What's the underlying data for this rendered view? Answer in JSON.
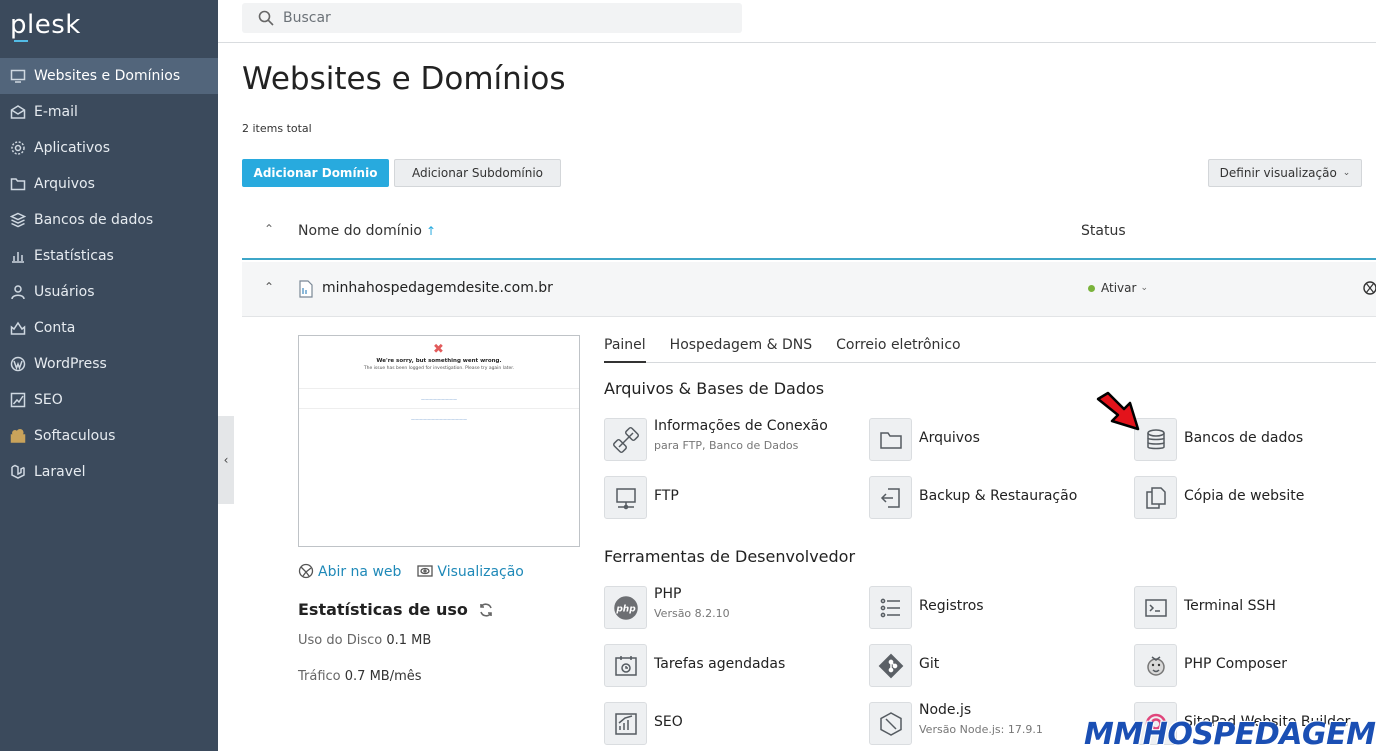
{
  "brand": {
    "logo": "plesk"
  },
  "search": {
    "placeholder": "Buscar"
  },
  "sidebar": {
    "items": [
      {
        "label": "Websites e Domínios",
        "icon": "monitor-icon",
        "active": true
      },
      {
        "label": "E-mail",
        "icon": "mail-icon"
      },
      {
        "label": "Aplicativos",
        "icon": "gear-icon"
      },
      {
        "label": "Arquivos",
        "icon": "folder-icon"
      },
      {
        "label": "Bancos de dados",
        "icon": "database-icon"
      },
      {
        "label": "Estatísticas",
        "icon": "bar-chart-icon"
      },
      {
        "label": "Usuários",
        "icon": "user-icon"
      },
      {
        "label": "Conta",
        "icon": "account-icon"
      },
      {
        "label": "WordPress",
        "icon": "wordpress-icon"
      },
      {
        "label": "SEO",
        "icon": "seo-icon"
      },
      {
        "label": "Softaculous",
        "icon": "softaculous-icon"
      },
      {
        "label": "Laravel",
        "icon": "laravel-icon"
      }
    ]
  },
  "page": {
    "title": "Websites e Domínios",
    "items_total": "2 items total",
    "add_domain": "Adicionar Domínio",
    "add_subdomain": "Adicionar Subdomínio",
    "set_view": "Definir visualização"
  },
  "list": {
    "col_name": "Nome do domínio",
    "col_status": "Status"
  },
  "domain": {
    "name": "minhahospedagemdesite.com.br",
    "status": "Ativar",
    "status_color": "#7ab33b"
  },
  "preview": {
    "title": "We're sorry, but something went wrong.",
    "subtitle": "The issue has been logged for investigation. Please try again later.",
    "open_web": "Abir na web",
    "visualization": "Visualização"
  },
  "stats": {
    "title": "Estatísticas de uso",
    "disk_label": "Uso do Disco",
    "disk_value": "0.1 MB",
    "traffic_label": "Tráfico",
    "traffic_value": "0.7 MB/mês"
  },
  "tabs": [
    "Painel",
    "Hospedagem & DNS",
    "Correio eletrônico"
  ],
  "sections": {
    "files": "Arquivos & Bases de Dados",
    "dev": "Ferramentas de Desenvolvedor"
  },
  "tools": {
    "connection": {
      "label": "Informações de Conexão",
      "sub": "para FTP, Banco de Dados"
    },
    "files": {
      "label": "Arquivos"
    },
    "databases": {
      "label": "Bancos de dados"
    },
    "ftp": {
      "label": "FTP"
    },
    "backup": {
      "label": "Backup & Restauração"
    },
    "copy": {
      "label": "Cópia de website"
    },
    "php": {
      "label": "PHP",
      "sub": "Versão 8.2.10"
    },
    "logs": {
      "label": "Registros"
    },
    "ssh": {
      "label": "Terminal SSH"
    },
    "cron": {
      "label": "Tarefas agendadas"
    },
    "git": {
      "label": "Git"
    },
    "composer": {
      "label": "PHP Composer"
    },
    "seo": {
      "label": "SEO"
    },
    "node": {
      "label": "Node.js",
      "sub": "Versão Node.js: 17.9.1"
    },
    "sitepad": {
      "label": "SitePad Website Builder"
    }
  },
  "watermark": "MMHOSPEDAGEM"
}
